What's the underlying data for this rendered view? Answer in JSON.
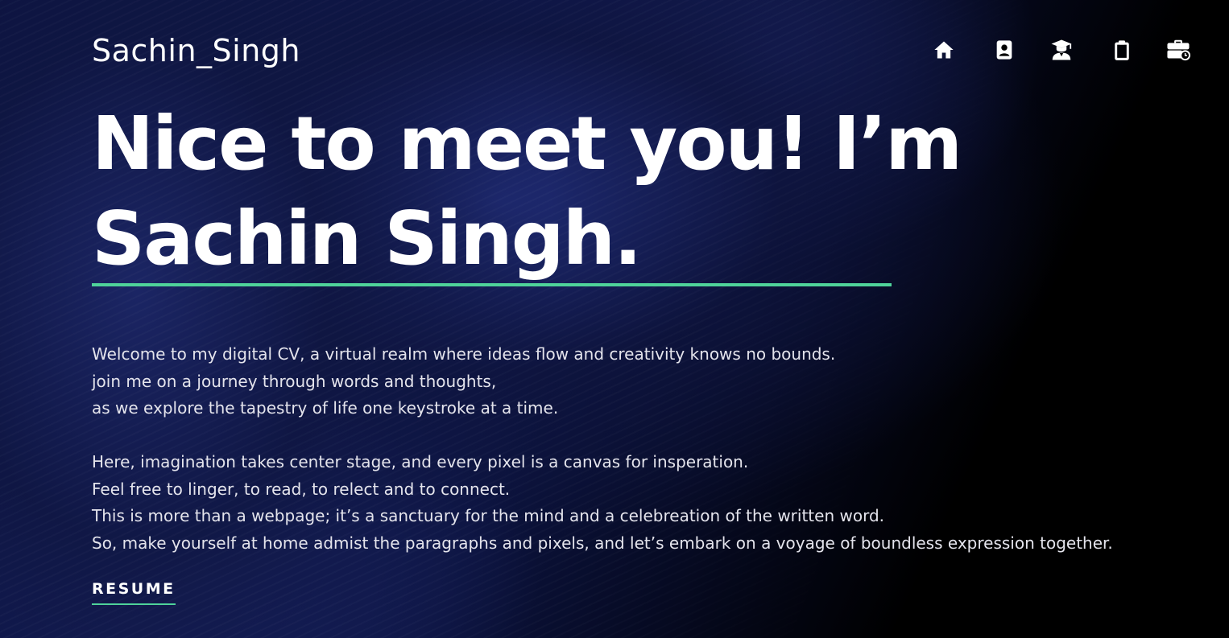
{
  "header": {
    "brand": "Sachin_Singh",
    "nav": [
      {
        "id": "home",
        "icon": "home-icon"
      },
      {
        "id": "contact",
        "icon": "contact-card-icon"
      },
      {
        "id": "education",
        "icon": "graduate-icon"
      },
      {
        "id": "clipboard",
        "icon": "clipboard-icon"
      },
      {
        "id": "experience",
        "icon": "briefcase-clock-icon"
      }
    ]
  },
  "hero": {
    "headline_line1": "Nice to meet you! I’m",
    "headline_line2": "Sachin Singh.",
    "intro": [
      "Welcome to my digital CV, a virtual realm where ideas flow and creativity knows no bounds.",
      "join me on a journey through words and thoughts,",
      "as we explore the tapestry of life one keystroke at a time.",
      "Here, imagination takes center stage, and every pixel is a canvas for insperation.",
      "Feel free to linger, to read, to relect and to connect.",
      "This is more than a webpage; it’s a sanctuary for the mind and a celebreation of the written word.",
      "So, make yourself at home admist the paragraphs and pixels, and let’s embark on a voyage of boundless expression together."
    ],
    "cta_label": "RESUME"
  },
  "colors": {
    "accent": "#4fd39a",
    "background_dark": "#000000",
    "background_navy": "#101a55",
    "text": "#ffffff",
    "body_text": "#e4e4ec"
  }
}
